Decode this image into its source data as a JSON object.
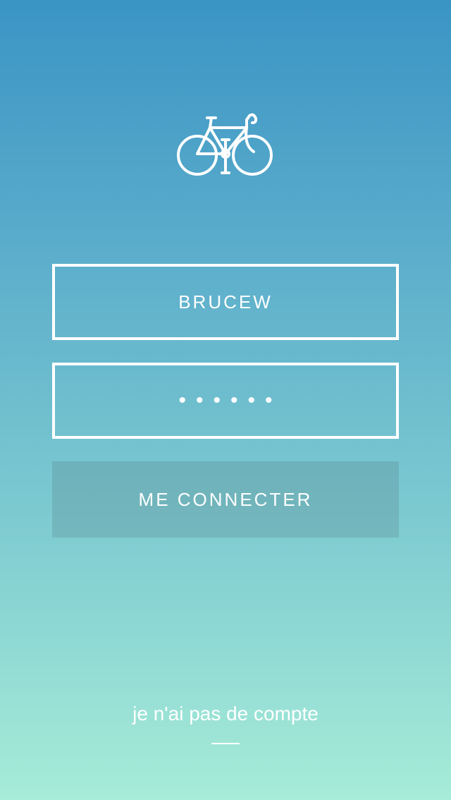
{
  "logo": {
    "icon": "bicycle-icon"
  },
  "login_form": {
    "username_value": "BRUCEW",
    "password_value": "••••••",
    "submit_label": "ME CONNECTER"
  },
  "footer": {
    "no_account_link": "je n'ai pas de compte"
  },
  "colors": {
    "gradient_top": "#3a94c4",
    "gradient_bottom": "#a7ecd8",
    "foreground": "#ffffff"
  }
}
